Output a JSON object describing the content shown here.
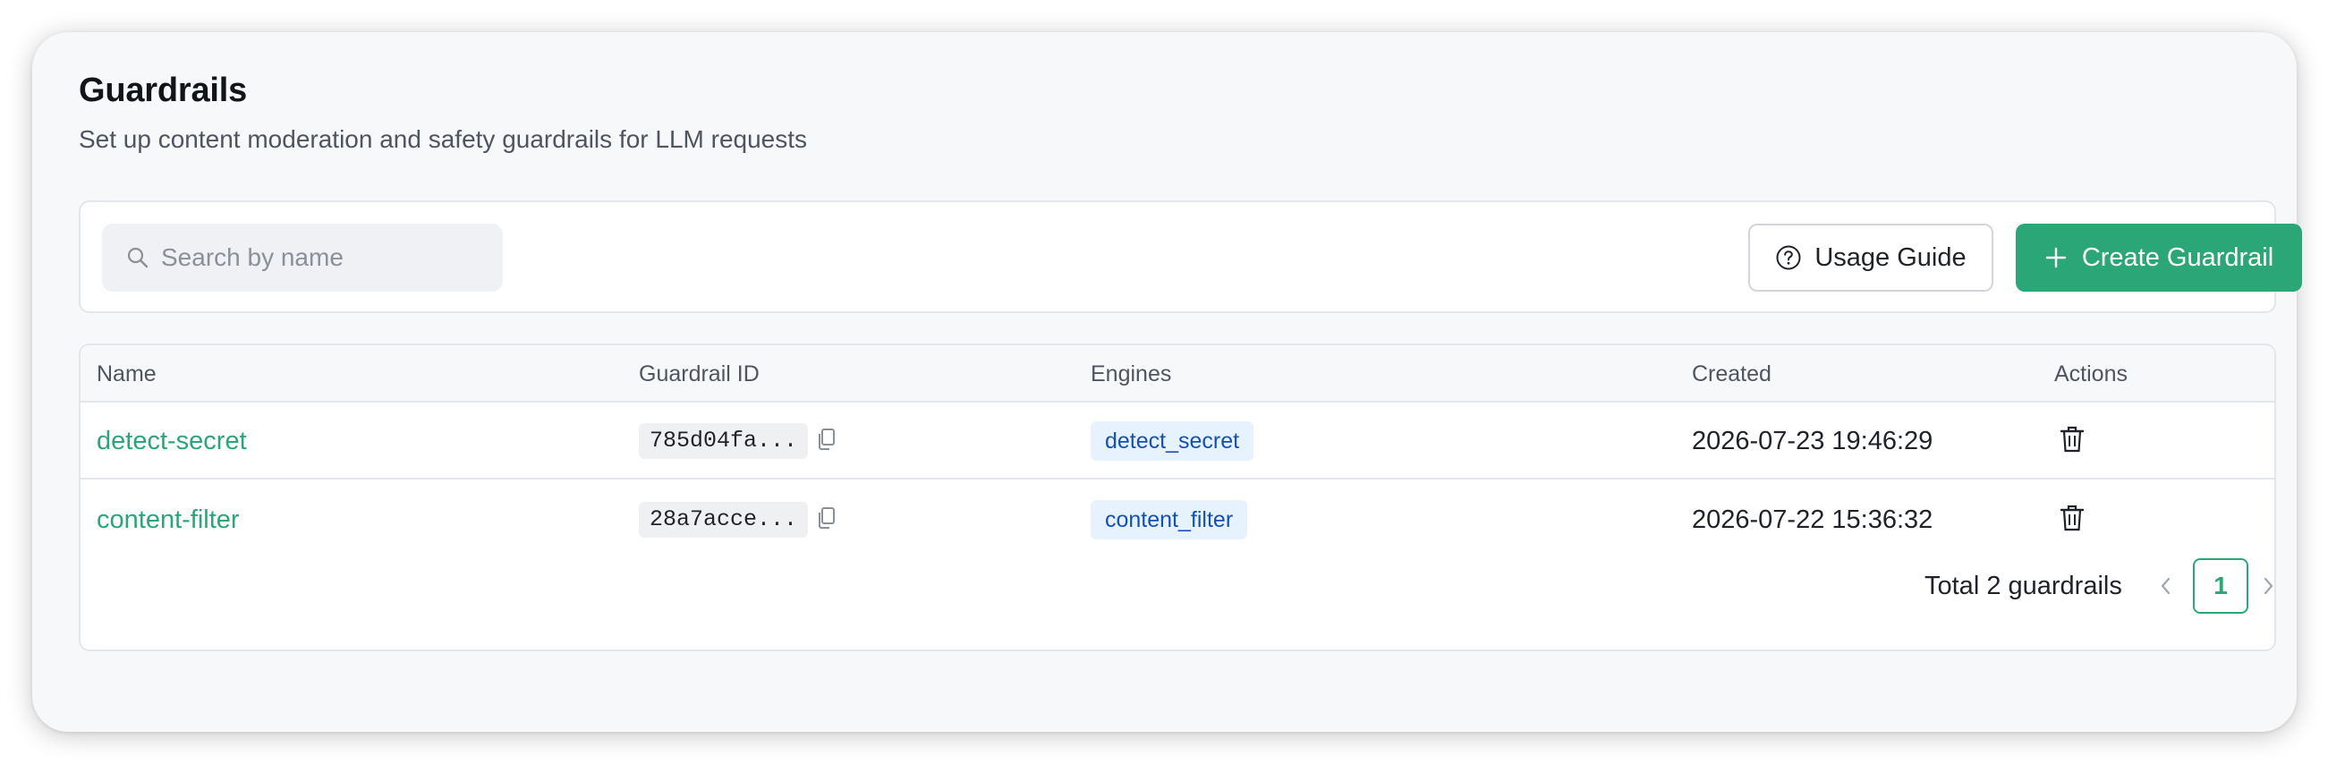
{
  "header": {
    "title": "Guardrails",
    "subtitle": "Set up content moderation and safety guardrails for LLM requests"
  },
  "toolbar": {
    "search_placeholder": "Search by name",
    "search_value": "",
    "usage_guide_label": "Usage Guide",
    "create_label": "Create Guardrail"
  },
  "table": {
    "columns": {
      "name": "Name",
      "id": "Guardrail ID",
      "engines": "Engines",
      "created": "Created",
      "actions": "Actions"
    },
    "rows": [
      {
        "name": "detect-secret",
        "id": "785d04fa...",
        "engine": "detect_secret",
        "created": "2026-07-23 19:46:29",
        "action_icon": "trash-icon"
      },
      {
        "name": "content-filter",
        "id": "28a7acce...",
        "engine": "content_filter",
        "created": "2026-07-22 15:36:32",
        "action_icon": "trash-icon"
      }
    ]
  },
  "pagination": {
    "total_label": "Total 2 guardrails",
    "current_page": "1"
  },
  "colors": {
    "accent": "#2ba677",
    "engine_tag_bg": "#e6f3ff",
    "engine_tag_text": "#1550b4",
    "card_bg": "#f7f8fa"
  }
}
